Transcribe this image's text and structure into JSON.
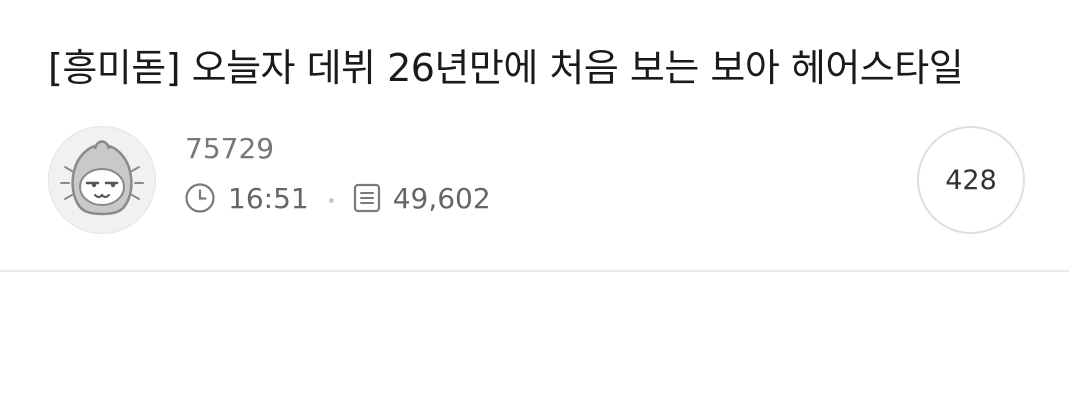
{
  "post": {
    "title": "[흥미돋] 오늘자 데뷔 26년만에 처음 보는 보아 헤어스타일",
    "author": "75729",
    "time": "16:51",
    "views": "49,602",
    "comments": "428"
  },
  "icons": {
    "avatar": "hooded-character-avatar",
    "time": "clock-icon",
    "views": "document-icon"
  }
}
